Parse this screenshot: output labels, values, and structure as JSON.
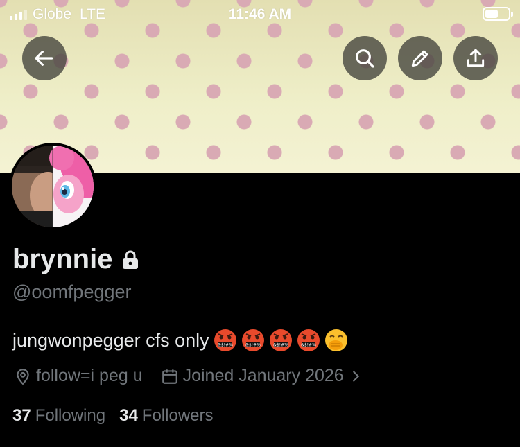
{
  "status_bar": {
    "carrier": "Globe",
    "network": "LTE",
    "time": "11:46 AM",
    "battery_level": 0.55,
    "signal_bars": 3
  },
  "header": {
    "back_icon": "arrow-left-icon",
    "actions": [
      "search-icon",
      "edit-pencil-icon",
      "share-upload-icon"
    ],
    "banner_colors": {
      "background": "#efefc9",
      "dots": "#d9aab4"
    }
  },
  "profile": {
    "display_name": "brynnie",
    "protected_icon": "lock-icon",
    "handle": "@oomfpegger",
    "bio_text": "jungwonpegger cfs only",
    "bio_emoji": [
      "face-with-symbols-on-mouth",
      "face-with-symbols-on-mouth",
      "face-with-symbols-on-mouth",
      "face-with-symbols-on-mouth",
      "face-with-hand-over-mouth"
    ],
    "location": "follow=i peg u",
    "joined": "Joined January 2026",
    "following_count": "37",
    "following_label": "Following",
    "followers_count": "34",
    "followers_label": "Followers"
  },
  "colors": {
    "background": "#000000",
    "text_primary": "#e7e9ea",
    "text_secondary": "#71767b"
  }
}
